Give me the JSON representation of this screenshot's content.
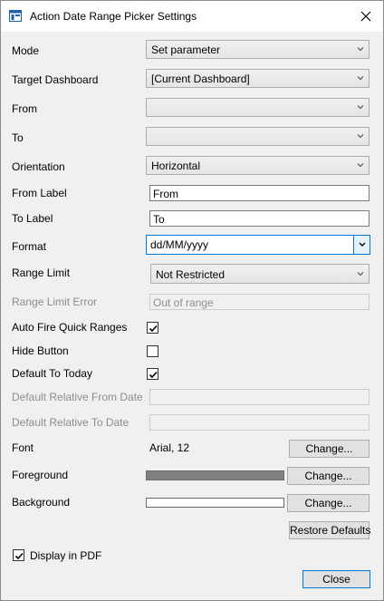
{
  "window": {
    "title": "Action Date Range Picker Settings"
  },
  "fields": {
    "mode": {
      "label": "Mode",
      "value": "Set parameter"
    },
    "target_dashboard": {
      "label": "Target Dashboard",
      "value": "[Current Dashboard]"
    },
    "from": {
      "label": "From",
      "value": ""
    },
    "to": {
      "label": "To",
      "value": ""
    },
    "orientation": {
      "label": "Orientation",
      "value": "Horizontal"
    },
    "from_label": {
      "label": "From Label",
      "value": "From"
    },
    "to_label": {
      "label": "To Label",
      "value": "To"
    },
    "format": {
      "label": "Format",
      "value": "dd/MM/yyyy"
    },
    "range_limit": {
      "label": "Range Limit",
      "value": "Not Restricted"
    },
    "range_limit_error": {
      "label": "Range Limit Error",
      "value": "Out of range"
    },
    "auto_fire": {
      "label": "Auto Fire Quick Ranges",
      "checked": true
    },
    "hide_button": {
      "label": "Hide Button",
      "checked": false
    },
    "default_today": {
      "label": "Default To Today",
      "checked": true
    },
    "default_rel_from": {
      "label": "Default Relative From Date",
      "value": ""
    },
    "default_rel_to": {
      "label": "Default Relative To Date",
      "value": ""
    },
    "font": {
      "label": "Font",
      "value": "Arial, 12",
      "button": "Change..."
    },
    "foreground": {
      "label": "Foreground",
      "color": "#808080",
      "button": "Change..."
    },
    "background": {
      "label": "Background",
      "color": "#ffffff",
      "button": "Change..."
    }
  },
  "restore_defaults": "Restore Defaults",
  "display_in_pdf": {
    "label": "Display in PDF",
    "checked": true
  },
  "close_button": "Close",
  "icons": {
    "app": "dialog-window-icon",
    "close": "close-icon",
    "dropdown": "chevron-down-icon",
    "check": "checkmark-icon"
  },
  "colors": {
    "accent": "#0078d7"
  }
}
